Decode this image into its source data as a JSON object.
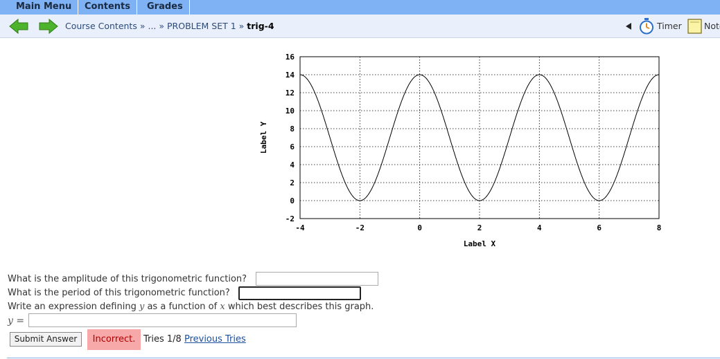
{
  "menu": {
    "items": [
      "Main Menu",
      "Contents",
      "Grades"
    ]
  },
  "nav": {
    "breadcrumbs": [
      "Course Contents",
      "...",
      "PROBLEM SET 1"
    ],
    "separator": "»",
    "current": "trig-4",
    "timer_label": "Timer",
    "notes_label": "Note"
  },
  "colors": {
    "menu_bg": "#7fb2f4",
    "nav_bg": "#eaf0fb",
    "arrow_green": "#4db32c",
    "incorrect_bg": "#f7a8a8"
  },
  "chart_data": {
    "type": "line",
    "xlabel": "Label X",
    "ylabel": "Label Y",
    "xlim": [
      -4,
      8
    ],
    "ylim": [
      -2,
      16
    ],
    "xticks": [
      -4,
      -2,
      0,
      2,
      4,
      6,
      8
    ],
    "yticks": [
      -2,
      0,
      2,
      4,
      6,
      8,
      10,
      12,
      14,
      16
    ],
    "grid": true,
    "series": [
      {
        "function": "y = 7*cos(pi*x/2) + 7",
        "x": [
          -4,
          -3.5,
          -3,
          -2.5,
          -2,
          -1.5,
          -1,
          -0.5,
          0,
          0.5,
          1,
          1.5,
          2,
          2.5,
          3,
          3.5,
          4,
          4.5,
          5,
          5.5,
          6,
          6.5,
          7,
          7.5,
          8
        ],
        "y": [
          14,
          11.95,
          7,
          2.05,
          0,
          2.05,
          7,
          11.95,
          14,
          11.95,
          7,
          2.05,
          0,
          2.05,
          7,
          11.95,
          14,
          11.95,
          7,
          2.05,
          0,
          2.05,
          7,
          11.95,
          14
        ]
      }
    ]
  },
  "questions": {
    "q1": "What is the amplitude of this trigonometric function?",
    "q2": "What is the period of this trigonometric function?",
    "q3_pre": "Write an expression defining",
    "q3_y": "y",
    "q3_mid": "as a function of",
    "q3_x": "x",
    "q3_post": "which best describes this graph.",
    "y_label": "y",
    "equals": "=",
    "answer1": "",
    "answer2": "",
    "answer3": ""
  },
  "submit": {
    "button_label": "Submit Answer",
    "status": "Incorrect.",
    "tries_text": "Tries 1/8",
    "previous_tries_label": "Previous Tries"
  }
}
